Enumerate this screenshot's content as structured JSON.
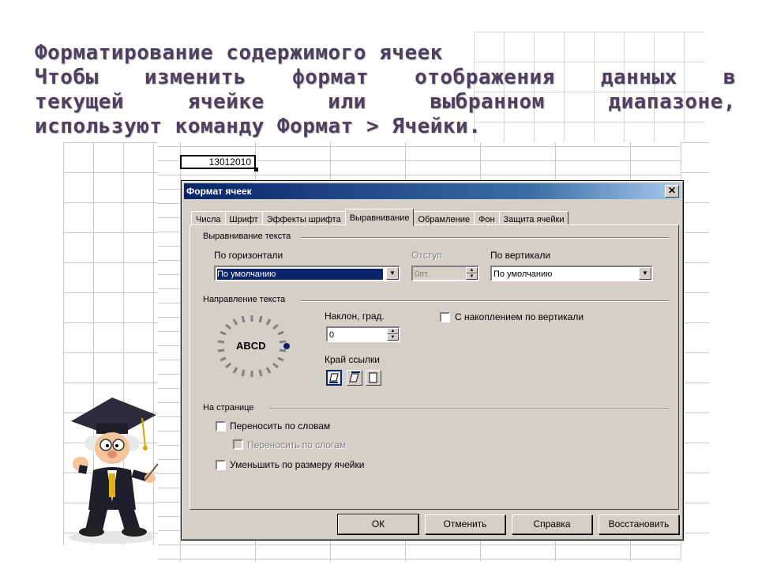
{
  "slide": {
    "title_line1": "Форматирование содержимого ячеек",
    "body_line1": "Чтобы изменить формат отображения данных в",
    "body_line2": "текущей ячейке или выбранном диапазоне,",
    "body_line3": "используют команду Формат > Ячейки."
  },
  "sheet": {
    "active_cell_value": "13012010"
  },
  "dialog": {
    "title": "Формат ячеек",
    "close_glyph": "✕",
    "tabs": [
      {
        "label": "Числа"
      },
      {
        "label": "Шрифт"
      },
      {
        "label": "Эффекты шрифта"
      },
      {
        "label": "Выравнивание",
        "active": true
      },
      {
        "label": "Обрамление"
      },
      {
        "label": "Фон"
      },
      {
        "label": "Защита ячейки"
      }
    ],
    "text_alignment": {
      "section": "Выравнивание текста",
      "horizontal_label": "По горизонтали",
      "horizontal_value": "По умолчанию",
      "indent_label": "Отступ",
      "indent_value": "0пт",
      "vertical_label": "По вертикали",
      "vertical_value": "По умолчанию"
    },
    "text_direction": {
      "section": "Направление текста",
      "dial_text": "ABCD",
      "tilt_label": "Наклон, град.",
      "tilt_value": "0",
      "ref_edge_label": "Край ссылки",
      "stacked_label": "С накоплением по вертикали",
      "stacked_checked": false
    },
    "on_page": {
      "section": "На странице",
      "wrap_words_label": "Переносить по словам",
      "wrap_words_checked": false,
      "hyphen_label": "Переносить по слогам",
      "hyphen_checked": false,
      "hyphen_disabled": true,
      "shrink_label": "Уменьшить по размеру ячейки",
      "shrink_checked": false
    },
    "buttons": {
      "ok": "ОК",
      "cancel": "Отменить",
      "help": "Справка",
      "reset": "Восстановить"
    }
  },
  "colors": {
    "title_text": "#4e3f5e",
    "titlebar_start": "#0a246a",
    "dialog_face": "#d4d0c8",
    "selection": "#0a246a"
  }
}
